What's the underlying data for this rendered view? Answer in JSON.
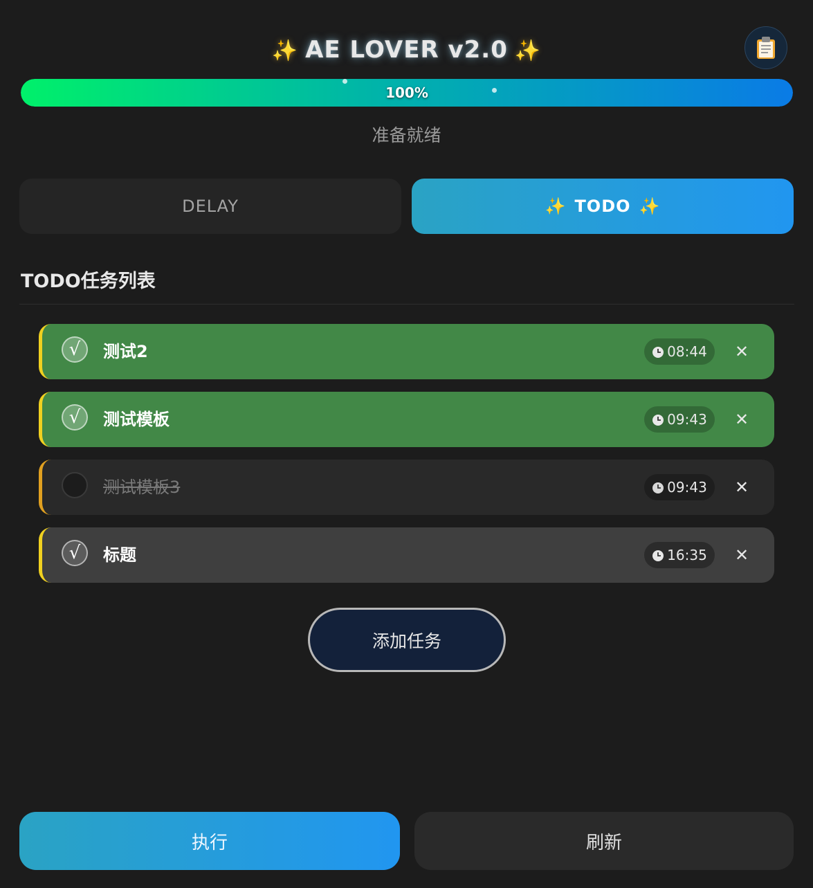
{
  "header": {
    "title": "AE LOVER v2.0",
    "sparkle_left": "✨",
    "sparkle_right": "✨",
    "clipboard_icon": "📋"
  },
  "progress": {
    "value": 1.0,
    "label": "100%",
    "status": "准备就绪"
  },
  "tabs": [
    {
      "label": "DELAY",
      "active": false
    },
    {
      "label": "TODO",
      "active": true,
      "sparkle": "✨"
    }
  ],
  "todo": {
    "section_title": "TODO任务列表",
    "tasks": [
      {
        "title": "测试2",
        "time": "08:44",
        "done": true,
        "check": "√"
      },
      {
        "title": "测试模板",
        "time": "09:43",
        "done": true,
        "check": "√"
      },
      {
        "title": "测试模板3",
        "time": "09:43",
        "done": false,
        "check": ""
      },
      {
        "title": "标题",
        "time": "16:35",
        "done": true,
        "check": "√"
      }
    ],
    "delete_glyph": "✕",
    "add_label": "添加任务"
  },
  "actions": {
    "execute_label": "执行",
    "refresh_label": "刷新"
  },
  "colors": {
    "background": "#1c1c1c",
    "accent_gradient_start": "#2aa3c4",
    "accent_gradient_end": "#2196f0",
    "done_green": "#428847",
    "progress_start": "#00f06a",
    "progress_end": "#0a7be6"
  }
}
